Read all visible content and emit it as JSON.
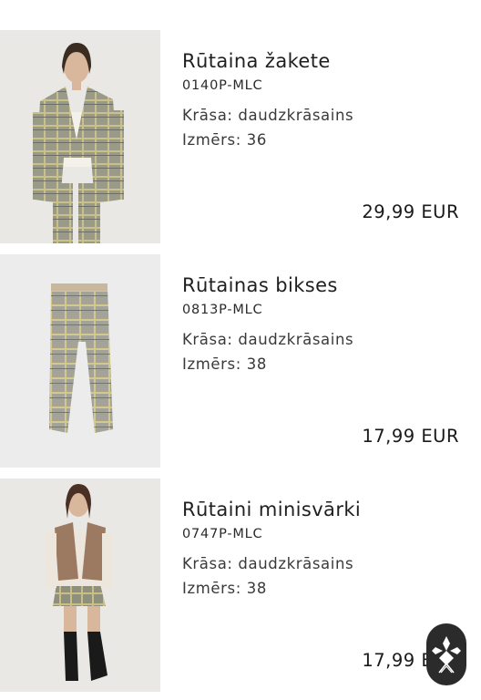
{
  "products": [
    {
      "title": "Rūtaina žakete",
      "sku": "0140P-MLC",
      "color": "Krāsa: daudzkrāsains",
      "size": "Izmērs: 36",
      "price": "29,99 EUR",
      "image": "woman-checked-blazer"
    },
    {
      "title": "Rūtainas bikses",
      "sku": "0813P-MLC",
      "color": "Krāsa: daudzkrāsains",
      "size": "Izmērs: 38",
      "price": "17,99 EUR",
      "image": "checked-trousers"
    },
    {
      "title": "Rūtaini minisvārki",
      "sku": "0747P-MLC",
      "color": "Krāsa: daudzkrāsains",
      "size": "Izmērs: 38",
      "price": "17,99 EUR",
      "image": "woman-checked-miniskirt"
    }
  ],
  "chat": {
    "icon": "chat-assistant-icon"
  },
  "colors": {
    "text": "#1f1f1f",
    "thumb_bg": "#e9e8e4",
    "badge": "#2b2b2b"
  }
}
